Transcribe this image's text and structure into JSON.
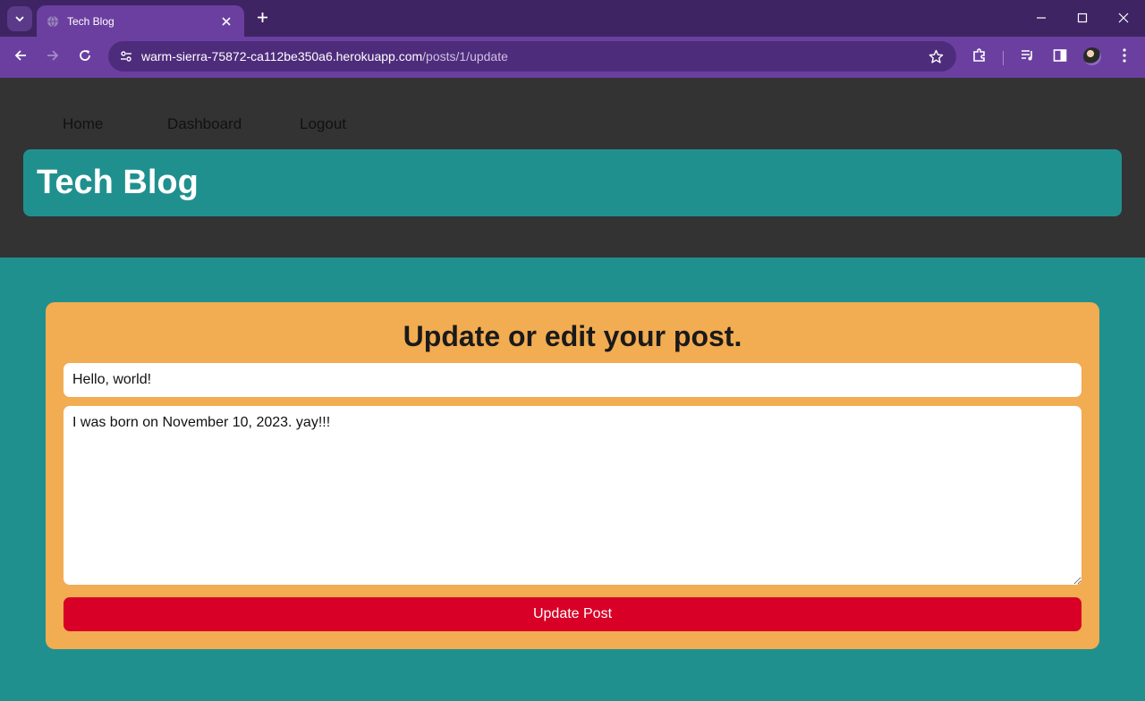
{
  "browser": {
    "tab_title": "Tech Blog",
    "url_host": "warm-sierra-75872-ca112be350a6.herokuapp.com",
    "url_path": "/posts/1/update",
    "icons": {
      "tab_search": "chevron-down-icon",
      "favicon": "globe-icon",
      "tab_close": "close-icon",
      "new_tab": "plus-icon",
      "minimize": "minimize-icon",
      "maximize": "maximize-icon",
      "close_window": "close-icon",
      "back": "arrow-left-icon",
      "forward": "arrow-right-icon",
      "reload": "reload-icon",
      "site_info": "tune-icon",
      "bookmark": "star-icon",
      "extensions": "puzzle-icon",
      "media": "media-queue-icon",
      "side_panel": "side-panel-icon",
      "menu": "kebab-menu-icon"
    },
    "colors": {
      "tabbar": "#3f2464",
      "toolbar": "#6b3fa0",
      "omnibox": "#4e2c7c"
    }
  },
  "nav": {
    "home": "Home",
    "dashboard": "Dashboard",
    "logout": "Logout"
  },
  "header": {
    "title": "Tech Blog"
  },
  "form": {
    "heading": "Update or edit your post.",
    "title_value": "Hello, world!",
    "body_value": "I was born on November 10, 2023. yay!!!",
    "submit_label": "Update Post"
  },
  "colors": {
    "header_bg": "#333333",
    "accent_teal": "#20908f",
    "card_orange": "#f2ac51",
    "button_red": "#d80027"
  }
}
